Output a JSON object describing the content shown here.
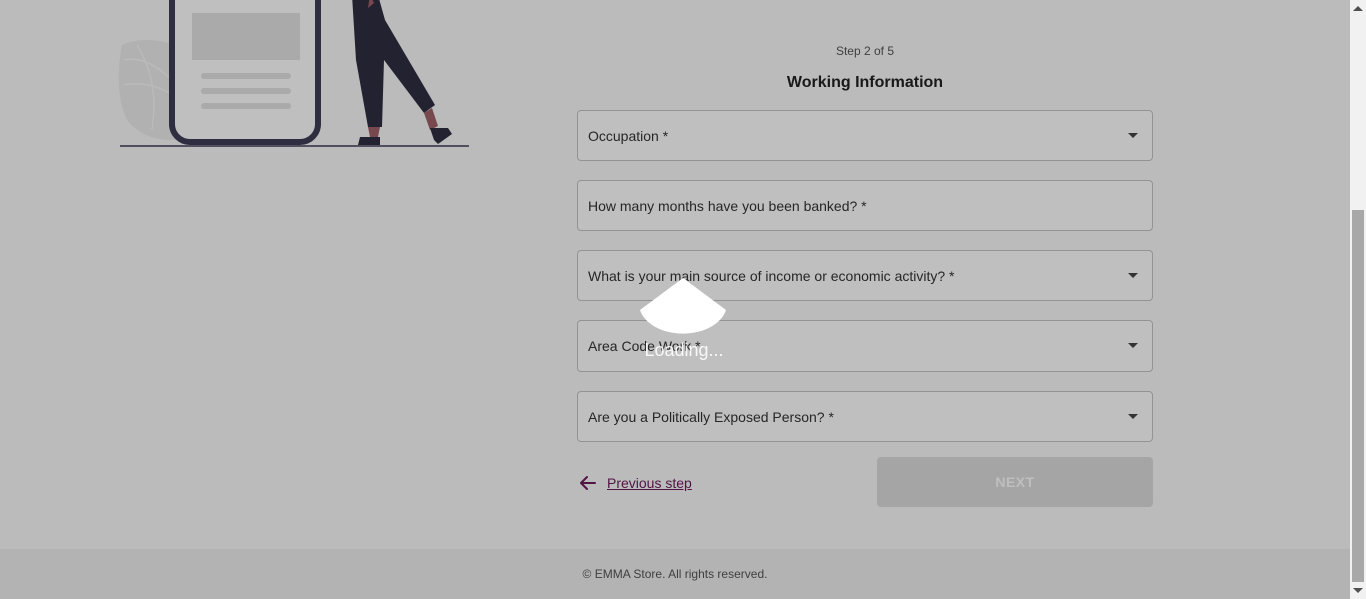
{
  "form": {
    "step_label": "Step 2 of 5",
    "title": "Working Information",
    "fields": [
      {
        "label": "Occupation *",
        "type": "select"
      },
      {
        "label": "How many months have you been banked? *",
        "type": "text"
      },
      {
        "label": "What is your main source of income or economic activity? *",
        "type": "select"
      },
      {
        "label": "Area Code Work *",
        "type": "select"
      },
      {
        "label": "Are you a Politically Exposed Person? *",
        "type": "select"
      }
    ],
    "previous_label": "Previous step",
    "next_label": "NEXT"
  },
  "footer": {
    "text": "© EMMA Store. All rights reserved."
  },
  "loading": {
    "text": "Loading..."
  },
  "icons": {
    "back": "arrow-left-icon",
    "dropdown": "caret-down-icon"
  },
  "colors": {
    "accent": "#6d1b5b",
    "button_disabled": "#dcdcdc",
    "overlay": "rgba(0,0,0,0.25)"
  }
}
